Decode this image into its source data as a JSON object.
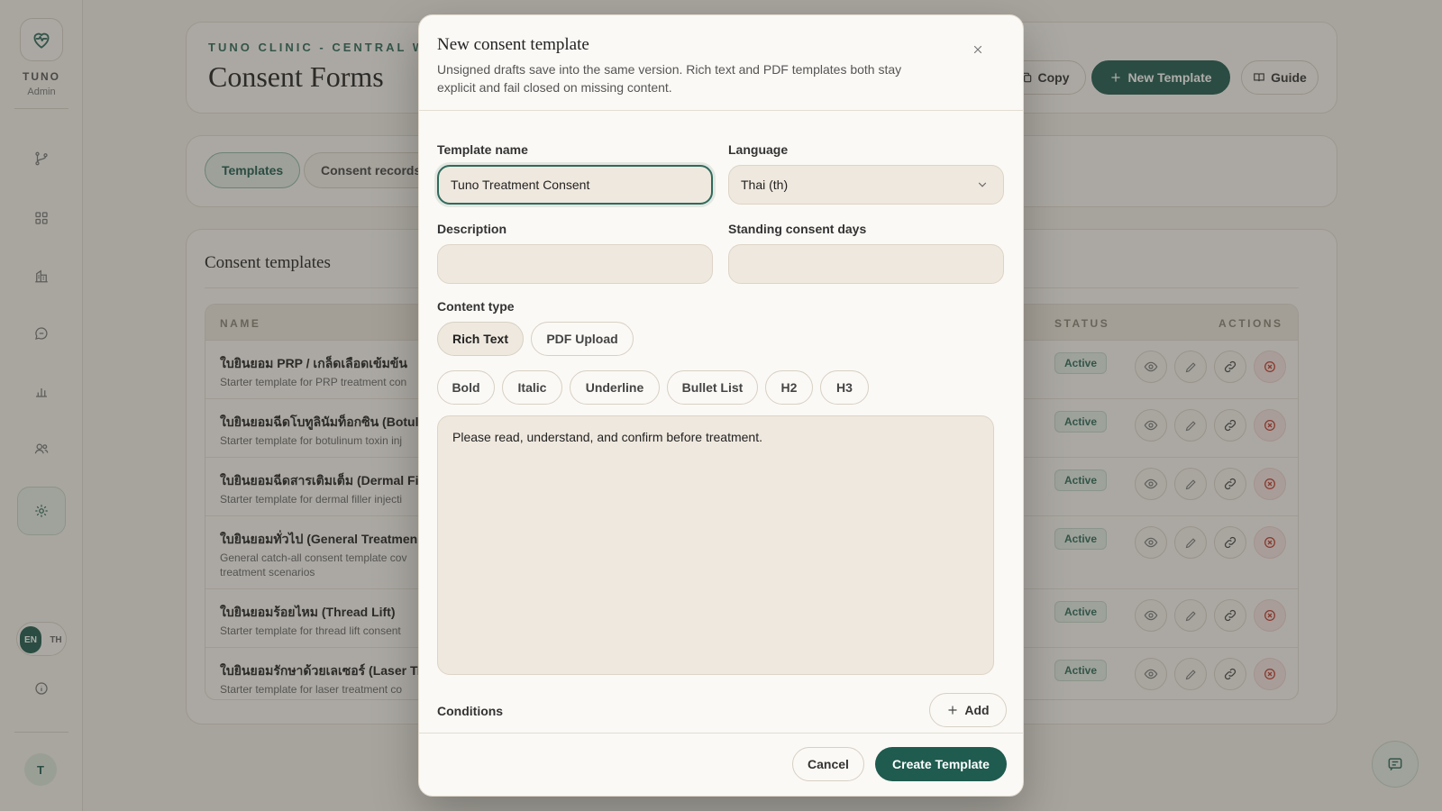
{
  "sidebar": {
    "brand": "TUNO",
    "role": "Admin",
    "nav_icons": [
      "branch-icon",
      "grid-icon",
      "building-icon",
      "chat-icon",
      "chart-icon",
      "users-icon",
      "settings-icon"
    ],
    "lang_en": "EN",
    "lang_th": "TH",
    "avatar_initial": "T"
  },
  "header": {
    "eyebrow": "TUNO CLINIC - CENTRAL WOR",
    "title": "Consent Forms",
    "copy_label": "Copy",
    "new_template_label": "New Template",
    "guide_label": "Guide"
  },
  "tabs": {
    "templates": "Templates",
    "records": "Consent records"
  },
  "templates_section": {
    "title": "Consent templates",
    "columns": {
      "name": "NAME",
      "status": "STATUS",
      "actions": "ACTIONS"
    },
    "rows": [
      {
        "name": "ใบยินยอม PRP / เกล็ดเลือดเข้มข้น",
        "desc": "Starter template for PRP treatment con",
        "status": "Active"
      },
      {
        "name": "ใบยินยอมฉีดโบทูลินัมท็อกซิน (Botulin",
        "desc": "Starter template for botulinum toxin inj",
        "status": "Active"
      },
      {
        "name": "ใบยินยอมฉีดสารเติมเต็ม (Dermal Fil",
        "desc": "Starter template for dermal filler injecti",
        "status": "Active"
      },
      {
        "name": "ใบยินยอมทั่วไป (General Treatmen",
        "desc": "General catch-all consent template cov treatment scenarios",
        "status": "Active"
      },
      {
        "name": "ใบยินยอมร้อยไหม (Thread Lift)",
        "desc": "Starter template for thread lift consent",
        "status": "Active"
      },
      {
        "name": "ใบยินยอมรักษาด้วยเลเซอร์ (Laser Tr",
        "desc": "Starter template for laser treatment co",
        "status": "Active"
      }
    ]
  },
  "modal": {
    "title": "New consent template",
    "subtitle": "Unsigned drafts save into the same version. Rich text and PDF templates both stay explicit and fail closed on missing content.",
    "template_name_label": "Template name",
    "template_name_value": "Tuno Treatment Consent",
    "language_label": "Language",
    "language_value": "Thai (th)",
    "description_label": "Description",
    "description_value": "",
    "standing_days_label": "Standing consent days",
    "standing_days_value": "",
    "content_type_label": "Content type",
    "content_types": [
      "Rich Text",
      "PDF Upload"
    ],
    "content_type_selected": "Rich Text",
    "toolbar": [
      "Bold",
      "Italic",
      "Underline",
      "Bullet List",
      "H2",
      "H3"
    ],
    "editor_text": "Please read, understand, and confirm before treatment.",
    "conditions_label": "Conditions",
    "add_label": "Add",
    "cancel_label": "Cancel",
    "create_label": "Create Template"
  },
  "colors": {
    "accent": "#1f5b4f",
    "background": "#f4f1ea",
    "status_active": "#2f6a5c",
    "danger": "#c0392b"
  }
}
